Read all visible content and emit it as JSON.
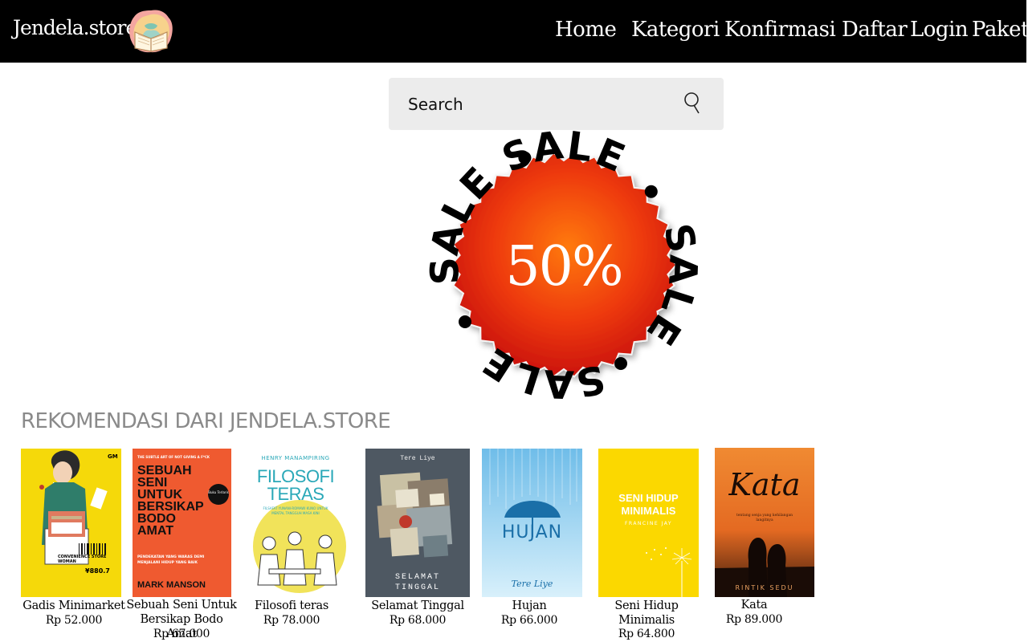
{
  "header": {
    "brand": "Jendela.store",
    "nav": [
      "Home",
      "Kategori",
      "Konfirmasi",
      "Daftar",
      "Login",
      "Paket"
    ]
  },
  "search": {
    "placeholder": "Search"
  },
  "promo": {
    "ring_text": "SALE",
    "percent": "50%"
  },
  "section": {
    "title": "REKOMENDASI DARI JENDELA.STORE"
  },
  "books": [
    {
      "title": "Gadis Minimarket",
      "price": "Rp 52.000"
    },
    {
      "title": "Sebuah Seni Untuk Bersikap Bodo Amat",
      "price": "Rp 67.000"
    },
    {
      "title": "Filosofi teras",
      "price": "Rp 78.000"
    },
    {
      "title": "Selamat Tinggal",
      "price": "Rp 68.000"
    },
    {
      "title": "Hujan",
      "price": "Rp 66.000"
    },
    {
      "title": "Seni Hidup Minimalis",
      "price": "Rp 64.800"
    },
    {
      "title": "Kata",
      "price": "Rp 89.000"
    }
  ],
  "covers": {
    "gadis": {
      "publisher": "GM",
      "line1": "CONVENIENCE STORE",
      "line2": "WOMAN",
      "price_tag": "¥880.7"
    },
    "sebuah": {
      "top": "THE SUBTLE ART OF NOT GIVING A F*CK",
      "lines": [
        "SEBUAH",
        "SENI",
        "UNTUK",
        "BERSIKAP",
        "BODO",
        "AMAT"
      ],
      "sub": "PENDEKATAN YANG WARAS DEMI MENJALANI HIDUP YANG BAIK",
      "author": "MARK MANSON",
      "sticker": "Buku Terlaris"
    },
    "filosofi": {
      "author": "HENRY MANAMPIRING",
      "lines": [
        "FILOSOFI",
        "TERAS"
      ],
      "sub": "FILSAFAT YUNANI-ROMAWI KUNO UNTUK MENTAL TANGGUH MASA KINI"
    },
    "selamat": {
      "author": "Tere Liye",
      "lines": [
        "SELAMAT",
        "TINGGAL"
      ]
    },
    "hujan": {
      "title": "HUJAN",
      "author": "Tere Liye"
    },
    "seni": {
      "lines": [
        "SENI HIDUP",
        "MINIMALIS"
      ],
      "author": "FRANCINE JAY"
    },
    "kata": {
      "title": "Kata",
      "sub": "tentang senja yang kehilangan langitnya",
      "author": "RINTIK SEDU"
    }
  },
  "colors": {
    "header_bg": "#000000",
    "badge_red": "#e8280c",
    "badge_center": "#ff6a10"
  }
}
